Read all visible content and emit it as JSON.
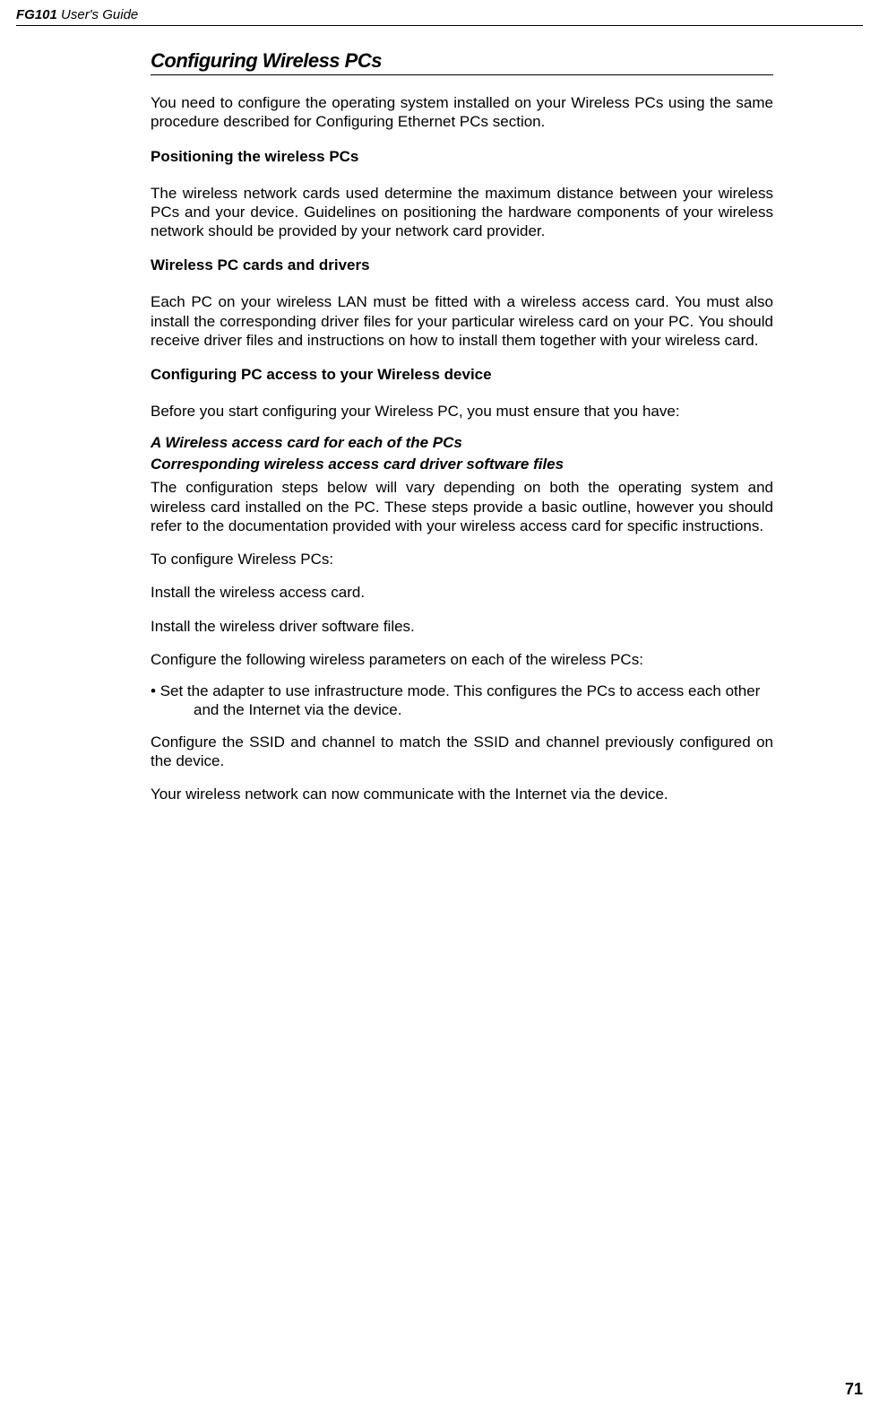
{
  "header": {
    "product": "FG101",
    "subtitle": " User's Guide"
  },
  "sectionTitle": "Configuring Wireless PCs",
  "intro": "You need to configure the operating system installed on your Wireless PCs using the same procedure described for Configuring Ethernet PCs section.",
  "sub1": {
    "heading": "Positioning the wireless PCs",
    "text": "The wireless network cards used determine the maximum distance between your wireless PCs and your device. Guidelines on positioning the hardware components of your wireless network should be provided by your network card provider."
  },
  "sub2": {
    "heading": "Wireless PC cards and drivers",
    "text": "Each PC on your wireless LAN must be fitted with a wireless access card. You must also install the corresponding driver files for your particular wireless card on your PC. You should receive driver files and instructions on how to install them together with your wireless card."
  },
  "sub3": {
    "heading": "Configuring PC access to your Wireless device",
    "lead": "Before you start configuring your Wireless PC, you must ensure that you have:",
    "req1": "A Wireless access card for each of the PCs",
    "req2": "Corresponding wireless access card driver software files",
    "para1": "The configuration steps below will vary depending on both the operating system and wireless card installed on the PC. These steps provide a basic outline, however you should refer to the documentation provided with your wireless access card for specific instructions.",
    "toConfigure": "To configure Wireless PCs:",
    "step1": "Install the wireless access card.",
    "step2": "Install the wireless driver software files.",
    "step3": "Configure the following wireless parameters on each of the wireless PCs:",
    "bullet": "Set the adapter to use infrastructure mode. This configures the PCs to access each other and the Internet via the device.",
    "para2": "Configure the SSID and channel to match the SSID and channel previously configured on the device.",
    "para3": "Your wireless network can now communicate with the Internet via the device."
  },
  "pageNumber": "71"
}
